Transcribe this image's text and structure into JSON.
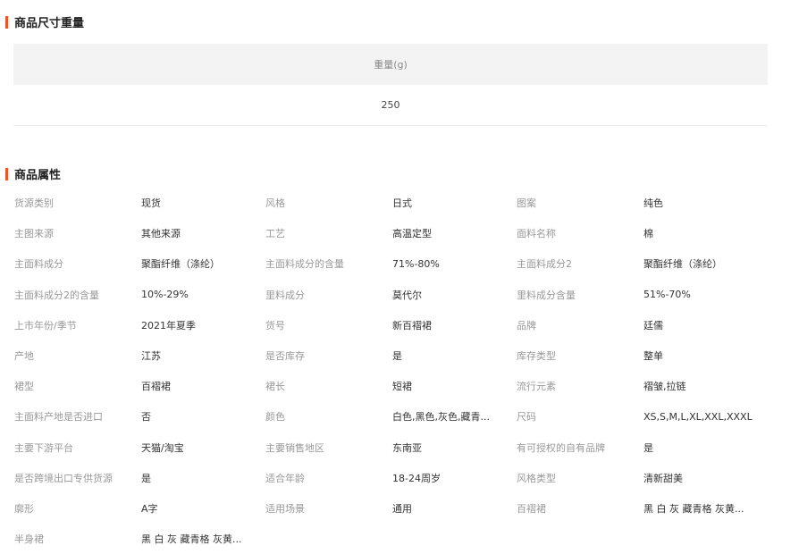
{
  "size_section": {
    "title": "商品尺寸重量",
    "header": "重量(g)",
    "value": "250"
  },
  "attr_section": {
    "title": "商品属性",
    "rows": [
      [
        [
          "货源类别",
          "现货"
        ],
        [
          "风格",
          "日式"
        ],
        [
          "图案",
          "纯色"
        ]
      ],
      [
        [
          "主图来源",
          "其他来源"
        ],
        [
          "工艺",
          "高温定型"
        ],
        [
          "面料名称",
          "棉"
        ]
      ],
      [
        [
          "主面料成分",
          "聚酯纤维（涤纶）"
        ],
        [
          "主面料成分的含量",
          "71%-80%"
        ],
        [
          "主面料成分2",
          "聚酯纤维（涤纶）"
        ]
      ],
      [
        [
          "主面料成分2的含量",
          "10%-29%"
        ],
        [
          "里料成分",
          "莫代尔"
        ],
        [
          "里料成分含量",
          "51%-70%"
        ]
      ],
      [
        [
          "上市年份/季节",
          "2021年夏季"
        ],
        [
          "货号",
          "新百褶裙"
        ],
        [
          "品牌",
          "廷儒"
        ]
      ],
      [
        [
          "产地",
          "江苏"
        ],
        [
          "是否库存",
          "是"
        ],
        [
          "库存类型",
          "整单"
        ]
      ],
      [
        [
          "裙型",
          "百褶裙"
        ],
        [
          "裙长",
          "短裙"
        ],
        [
          "流行元素",
          "褶皱,拉链"
        ]
      ],
      [
        [
          "主面料产地是否进口",
          "否"
        ],
        [
          "颜色",
          "白色,黑色,灰色,藏青..."
        ],
        [
          "尺码",
          "XS,S,M,L,XL,XXL,XXXL"
        ]
      ],
      [
        [
          "主要下游平台",
          "天猫/淘宝"
        ],
        [
          "主要销售地区",
          "东南亚"
        ],
        [
          "有可授权的自有品牌",
          "是"
        ]
      ],
      [
        [
          "是否跨境出口专供货源",
          "是"
        ],
        [
          "适合年龄",
          "18-24周岁"
        ],
        [
          "风格类型",
          "清新甜美"
        ]
      ],
      [
        [
          "廓形",
          "A字"
        ],
        [
          "适用场景",
          "通用"
        ],
        [
          "百褶裙",
          "黑 白 灰 藏青格 灰黄..."
        ]
      ],
      [
        [
          "半身裙",
          "黑 白 灰 藏青格 灰黄..."
        ]
      ]
    ]
  },
  "colors": {
    "accent": "#e4572e",
    "header_bg": "#f3f3f3"
  }
}
